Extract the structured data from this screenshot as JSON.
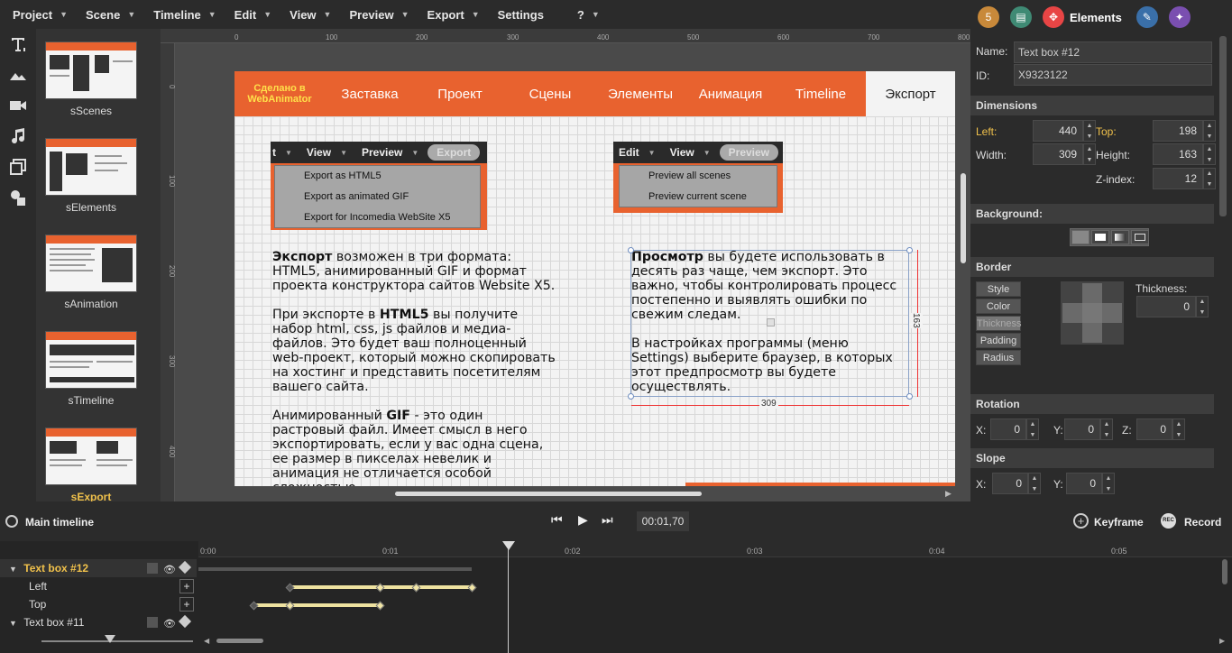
{
  "menubar": {
    "items": [
      {
        "label": "Project"
      },
      {
        "label": "Scene"
      },
      {
        "label": "Timeline"
      },
      {
        "label": "Edit"
      },
      {
        "label": "View"
      },
      {
        "label": "Preview"
      },
      {
        "label": "Export"
      },
      {
        "label": "Settings"
      },
      {
        "label": "?"
      }
    ]
  },
  "tools": [
    "text-tool-icon",
    "image-tool-icon",
    "video-tool-icon",
    "audio-tool-icon",
    "layers-tool-icon",
    "shapes-tool-icon"
  ],
  "scenes": [
    {
      "label": "sScenes"
    },
    {
      "label": "sElements"
    },
    {
      "label": "sAnimation"
    },
    {
      "label": "sTimeline"
    },
    {
      "label": "sExport"
    }
  ],
  "ruler": {
    "top": [
      "0",
      "100",
      "200",
      "300",
      "400",
      "500",
      "600",
      "700",
      "800"
    ],
    "left": [
      "0",
      "100",
      "200",
      "300",
      "400"
    ]
  },
  "site": {
    "brand": "Сделано в WebAnimator",
    "nav": [
      "Заставка",
      "Проект",
      "Сцены",
      "Элементы",
      "Анимация",
      "Timeline"
    ],
    "active_nav": "Экспорт",
    "shot1": {
      "menus": [
        "t",
        "View",
        "Preview",
        "Export"
      ],
      "dropdown": [
        "Export as HTML5",
        "Export as animated GIF",
        "Export for Incomedia WebSite X5"
      ]
    },
    "shot2": {
      "menus": [
        "Edit",
        "View",
        "Preview"
      ],
      "dropdown": [
        "Preview all scenes",
        "Preview current scene"
      ]
    },
    "text_left": {
      "p1_bold": "Экспорт",
      "p1_rest": " возможен в три формата: HTML5, анимированный GIF и формат проекта конструктора сайтов Website X5.",
      "p2_a": "При экспорте в ",
      "p2_bold": "HTML5",
      "p2_b": " вы получите набор html, css, js файлов и медиа-файлов. Это будет ваш полноценный web-проект, который можно скопировать на хостинг и представить посетителям вашего сайта.",
      "p3_a": "Анимированный ",
      "p3_bold": "GIF",
      "p3_b": " - это один растровый  файл. Имеет смысл в него экспортировать, если у вас одна сцена, ее размер в пикселах невелик и анимация не отличается особой сложностью."
    },
    "text_right": {
      "p1_bold": "Просмотр",
      "p1_rest": " вы будете использовать в десять раз чаще, чем экспорт. Это важно, чтобы контролировать процесс постепенно и выявлять ошибки по свежим следам.",
      "p2": "В настройках программы (меню Settings) выберите браузер, в которых этот предпросмотр вы будете осуществлять."
    },
    "dim_width": "309",
    "dim_height": "163"
  },
  "panel": {
    "tab_label": "Elements",
    "name_label": "Name:",
    "name_value": "Text box #12",
    "id_label": "ID:",
    "id_value": "X9323122",
    "dimensions_title": "Dimensions",
    "left_label": "Left:",
    "left_value": "440",
    "top_label": "Top:",
    "top_value": "198",
    "width_label": "Width:",
    "width_value": "309",
    "height_label": "Height:",
    "height_value": "163",
    "zindex_label": "Z-index:",
    "zindex_value": "12",
    "background_title": "Background:",
    "border_title": "Border",
    "border_buttons": [
      "Style",
      "Color",
      "Thickness",
      "Padding",
      "Radius"
    ],
    "thickness_label": "Thickness:",
    "thickness_value": "0",
    "rotation_title": "Rotation",
    "rot_x_label": "X:",
    "rot_x": "0",
    "rot_y_label": "Y:",
    "rot_y": "0",
    "rot_z_label": "Z:",
    "rot_z": "0",
    "slope_title": "Slope",
    "slope_x_label": "X:",
    "slope_x": "0",
    "slope_y_label": "Y:",
    "slope_y": "0"
  },
  "timeline": {
    "title": "Main timeline",
    "time": "00:01,70",
    "keyframe_label": "Keyframe",
    "record_label": "Record",
    "ticks": [
      "0:00",
      "0:01",
      "0:02",
      "0:03",
      "0:04",
      "0:05"
    ],
    "tracks": [
      {
        "label": "Text box #12"
      },
      {
        "label": "Left"
      },
      {
        "label": "Top"
      },
      {
        "label": "Text box #11"
      }
    ]
  },
  "colors": {
    "accent": "#e8622f",
    "selected_scene": "#f0c14b",
    "keyframe": "#f2e6a6"
  }
}
